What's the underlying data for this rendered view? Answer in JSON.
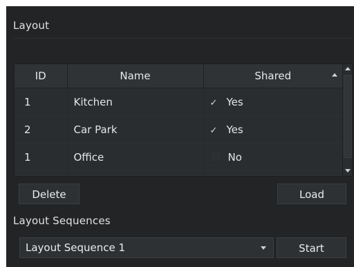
{
  "layout_section": {
    "title": "Layout",
    "table": {
      "columns": [
        "ID",
        "Name",
        "Shared"
      ],
      "rows": [
        {
          "id": "1",
          "name": "Kitchen",
          "shared": "Yes",
          "checked": true
        },
        {
          "id": "2",
          "name": "Car Park",
          "shared": "Yes",
          "checked": true
        },
        {
          "id": "1",
          "name": "Office",
          "shared": "No",
          "checked": false
        }
      ]
    },
    "delete_label": "Delete",
    "load_label": "Load",
    "check_glyph": "✓"
  },
  "sequence_section": {
    "title": "Layout Sequences",
    "selected": "Layout Sequence 1",
    "start_label": "Start"
  },
  "colors": {
    "background": "#222426",
    "table_bg": "#2a2d30",
    "header_bg": "#303336",
    "button_bg": "#2e3134",
    "text": "#e6e6e6"
  }
}
